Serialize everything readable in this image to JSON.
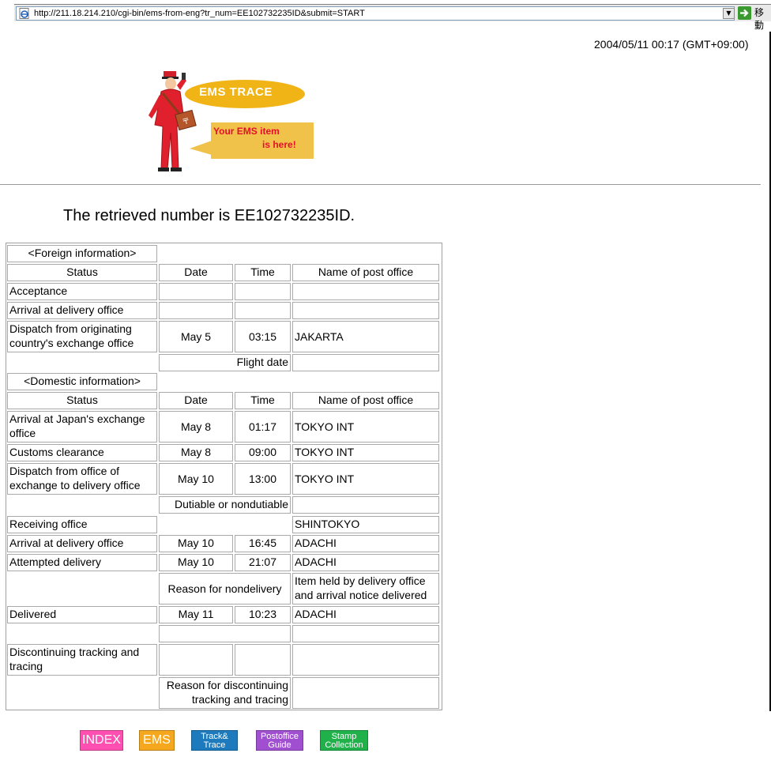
{
  "browser": {
    "url": "http://211.18.214.210/cgi-bin/ems-from-eng?tr_num=EE102732235ID&submit=START",
    "go_label": "移動"
  },
  "page": {
    "timestamp": "2004/05/11 00:17 (GMT+09:00)",
    "logo": {
      "bubble_title": "EMS  TRACE",
      "bubble_line1": "Your EMS item",
      "bubble_line2": "is here!"
    },
    "retrieved": "The retrieved number is EE102732235ID."
  },
  "table": {
    "foreign_header": "<Foreign information>",
    "domestic_header": "<Domestic information>",
    "columns": {
      "status": "Status",
      "date": "Date",
      "time": "Time",
      "office": "Name of post office"
    },
    "foreign_rows": [
      {
        "status": "Acceptance",
        "date": "",
        "time": "",
        "office": ""
      },
      {
        "status": "Arrival at delivery office",
        "date": "",
        "time": "",
        "office": ""
      },
      {
        "status_line1": "Dispatch from originating",
        "status_line2": "country's exchange office",
        "date": "May 5",
        "time": "03:15",
        "office": "JAKARTA"
      }
    ],
    "flight_date_label": "Flight date",
    "domestic_rows": [
      {
        "status_line1": "Arrival at Japan's exchange",
        "status_line2": "office",
        "date": "May 8",
        "time": "01:17",
        "office": "TOKYO INT"
      },
      {
        "status": "Customs clearance",
        "date": "May 8",
        "time": "09:00",
        "office": "TOKYO INT"
      },
      {
        "status_line1": "Dispatch from office of",
        "status_line2": "exchange to delivery office",
        "date": "May 10",
        "time": "13:00",
        "office": "TOKYO INT"
      }
    ],
    "dutiable_label": "Dutiable or nondutiable",
    "receiving_office": {
      "status": "Receiving office",
      "office": "SHINTOKYO"
    },
    "arrival_delivery": {
      "status": "Arrival at delivery office",
      "date": "May 10",
      "time": "16:45",
      "office": "ADACHI"
    },
    "attempted_delivery": {
      "status": "Attempted delivery",
      "date": "May 10",
      "time": "21:07",
      "office": "ADACHI"
    },
    "nondelivery_label": "Reason for nondelivery",
    "nondelivery_value_line1": "Item held by delivery office",
    "nondelivery_value_line2": "and arrival notice delivered",
    "delivered": {
      "status": "Delivered",
      "date": "May 11",
      "time": "10:23",
      "office": "ADACHI"
    },
    "discontinuing": {
      "status_line1": "Discontinuing tracking and",
      "status_line2": "tracing"
    },
    "discontinuing_reason_line1": "Reason for discontinuing",
    "discontinuing_reason_line2": "tracking and tracing"
  },
  "nav": [
    {
      "label": "INDEX",
      "color": "#ff4fb1"
    },
    {
      "label": "EMS",
      "color": "#f5a81e"
    },
    {
      "label_line1": "Track&",
      "label_line2": "Trace",
      "color": "#1d7bbd"
    },
    {
      "label_line1": "Postoffice",
      "label_line2": "Guide",
      "color": "#a04fd1"
    },
    {
      "label_line1": "Stamp",
      "label_line2": "Collection",
      "color": "#21b14a"
    }
  ]
}
